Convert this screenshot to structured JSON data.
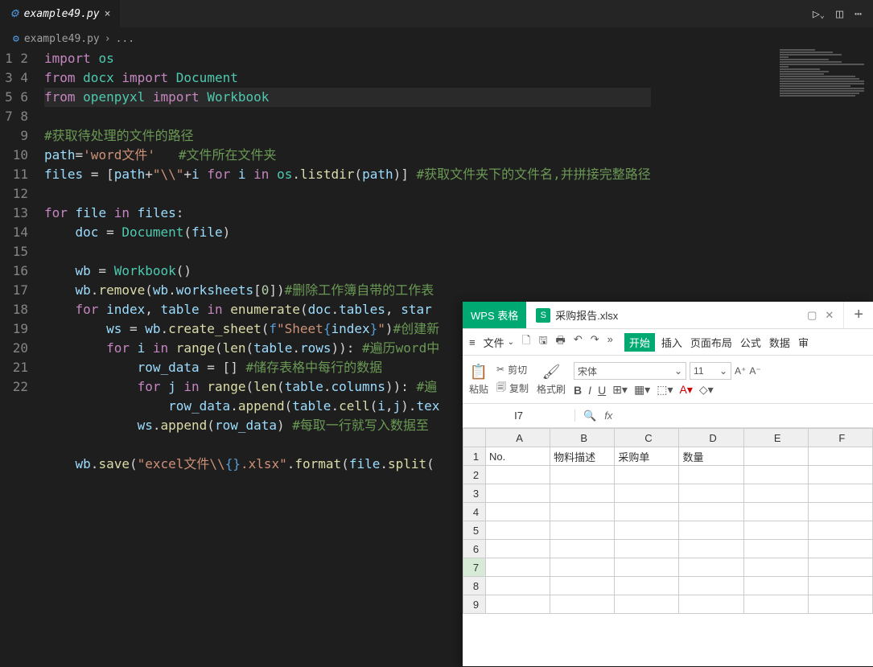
{
  "vscode": {
    "tab_name": "example49.py",
    "breadcrumb_file": "example49.py",
    "breadcrumb_more": "...",
    "run_icon": "▷",
    "split_icon": "▯▯",
    "more_icon": "⋯",
    "close": "×",
    "code_lines": [
      {
        "n": 1
      },
      {
        "n": 2
      },
      {
        "n": 3
      },
      {
        "n": 4
      },
      {
        "n": 5
      },
      {
        "n": 6
      },
      {
        "n": 7
      },
      {
        "n": 8
      },
      {
        "n": 9
      },
      {
        "n": 10
      },
      {
        "n": 11
      },
      {
        "n": 12
      },
      {
        "n": 13
      },
      {
        "n": 14
      },
      {
        "n": 15
      },
      {
        "n": 16
      },
      {
        "n": 17
      },
      {
        "n": 18
      },
      {
        "n": 19
      },
      {
        "n": 20
      },
      {
        "n": 21
      },
      {
        "n": 22
      }
    ],
    "code": {
      "l1_import": "import",
      "l1_os": "os",
      "l2_from": "from",
      "l2_docx": "docx",
      "l2_import": "import",
      "l2_Document": "Document",
      "l3_from": "from",
      "l3_openpyxl": "openpyxl",
      "l3_import": "import",
      "l3_Workbook": "Workbook",
      "l5_comment": "#获取待处理的文件的路径",
      "l6_path": "path",
      "l6_eq": "=",
      "l6_str": "'word文件'",
      "l6_comment": "#文件所在文件夹",
      "l7_files": "files",
      "l7_eq": "= [",
      "l7_path": "path",
      "l7_plus1": "+",
      "l7_s1": "\"\\\\\"",
      "l7_plus2": "+",
      "l7_i": "i",
      "l7_for": "for",
      "l7_i2": "i",
      "l7_in": "in",
      "l7_os": "os",
      "l7_dot": ".",
      "l7_list": "listdir",
      "l7_paren": "(",
      "l7_path2": "path",
      "l7_paren2": ")] ",
      "l7_comment": "#获取文件夹下的文件名,并拼接完整路径",
      "l9_for": "for",
      "l9_file": "file",
      "l9_in": "in",
      "l9_files": "files",
      "l9_colon": ":",
      "l10_doc": "doc",
      "l10_eq": " = ",
      "l10_Document": "Document",
      "l10_paren": "(",
      "l10_file": "file",
      "l10_paren2": ")",
      "l12_wb": "wb",
      "l12_eq": " = ",
      "l12_Workbook": "Workbook",
      "l12_paren": "()",
      "l13_wb": "wb",
      "l13_dot": ".",
      "l13_remove": "remove",
      "l13_paren": "(",
      "l13_wb2": "wb",
      "l13_dot2": ".",
      "l13_ws": "worksheets",
      "l13_b": "[",
      "l13_zero": "0",
      "l13_b2": "])",
      "l13_comment": "#删除工作簿自带的工作表",
      "l14_for": "for",
      "l14_index": "index",
      "l14_comma": ", ",
      "l14_table": "table",
      "l14_in": "in",
      "l14_enum": "enumerate",
      "l14_paren": "(",
      "l14_doc": "doc",
      "l14_dot": ".",
      "l14_tables": "tables",
      "l14_comma2": ", ",
      "l14_start": "star",
      "l15_ws": "ws",
      "l15_eq": " = ",
      "l15_wb": "wb",
      "l15_dot": ".",
      "l15_cs": "create_sheet",
      "l15_paren": "(",
      "l15_f": "f",
      "l15_str": "\"Sheet",
      "l15_br": "{",
      "l15_index": "index",
      "l15_br2": "}",
      "l15_strend": "\"",
      "l15_paren2": ")",
      "l15_comment": "#创建新",
      "l16_for": "for",
      "l16_i": "i",
      "l16_in": "in",
      "l16_range": "range",
      "l16_paren": "(",
      "l16_len": "len",
      "l16_paren2": "(",
      "l16_table": "table",
      "l16_dot": ".",
      "l16_rows": "rows",
      "l16_paren3": ")): ",
      "l16_comment": "#遍历word中",
      "l17_rd": "row_data",
      "l17_eq": " = [] ",
      "l17_comment": "#储存表格中每行的数据",
      "l18_for": "for",
      "l18_j": "j",
      "l18_in": "in",
      "l18_range": "range",
      "l18_paren": "(",
      "l18_len": "len",
      "l18_paren2": "(",
      "l18_table": "table",
      "l18_dot": ".",
      "l18_cols": "columns",
      "l18_paren3": ")): ",
      "l18_comment": "#遍",
      "l19_rd": "row_data",
      "l19_dot": ".",
      "l19_append": "append",
      "l19_paren": "(",
      "l19_table": "table",
      "l19_dot2": ".",
      "l19_cell": "cell",
      "l19_paren2": "(",
      "l19_i": "i",
      "l19_comma": ",",
      "l19_j": "j",
      "l19_paren3": ").",
      "l19_tex": "tex",
      "l20_ws": "ws",
      "l20_dot": ".",
      "l20_append": "append",
      "l20_paren": "(",
      "l20_rd": "row_data",
      "l20_paren2": ") ",
      "l20_comment": "#每取一行就写入数据至",
      "l22_wb": "wb",
      "l22_dot": ".",
      "l22_save": "save",
      "l22_paren": "(",
      "l22_str": "\"excel文件\\\\",
      "l22_br": "{}",
      "l22_str2": ".xlsx\"",
      "l22_dot2": ".",
      "l22_format": "format",
      "l22_paren2": "(",
      "l22_file": "file",
      "l22_dot3": ".",
      "l22_split": "split",
      "l22_paren3": "("
    }
  },
  "wps": {
    "brand": "WPS 表格",
    "file_name": "采购报告.xlsx",
    "add_tab": "+",
    "menu_file": "文件",
    "tabs": {
      "start": "开始",
      "insert": "插入",
      "layout": "页面布局",
      "formula": "公式",
      "data": "数据",
      "review": "审"
    },
    "paste": "粘贴",
    "cut": "剪切",
    "copy": "复制",
    "format_painter": "格式刷",
    "font_name": "宋体",
    "font_size": "11",
    "selected_cell": "I7",
    "fx": "fx",
    "columns": [
      "A",
      "B",
      "C",
      "D",
      "E",
      "F"
    ],
    "rows": [
      {
        "n": 1,
        "cells": [
          "No.",
          "物料描述",
          "采购单",
          "数量",
          "",
          ""
        ]
      },
      {
        "n": 2,
        "cells": [
          "",
          "",
          "",
          "",
          "",
          ""
        ]
      },
      {
        "n": 3,
        "cells": [
          "",
          "",
          "",
          "",
          "",
          ""
        ]
      },
      {
        "n": 4,
        "cells": [
          "",
          "",
          "",
          "",
          "",
          ""
        ]
      },
      {
        "n": 5,
        "cells": [
          "",
          "",
          "",
          "",
          "",
          ""
        ]
      },
      {
        "n": 6,
        "cells": [
          "",
          "",
          "",
          "",
          "",
          ""
        ]
      },
      {
        "n": 7,
        "cells": [
          "",
          "",
          "",
          "",
          "",
          ""
        ]
      },
      {
        "n": 8,
        "cells": [
          "",
          "",
          "",
          "",
          "",
          ""
        ]
      },
      {
        "n": 9,
        "cells": [
          "",
          "",
          "",
          "",
          "",
          ""
        ]
      }
    ],
    "selected_row": 7
  }
}
